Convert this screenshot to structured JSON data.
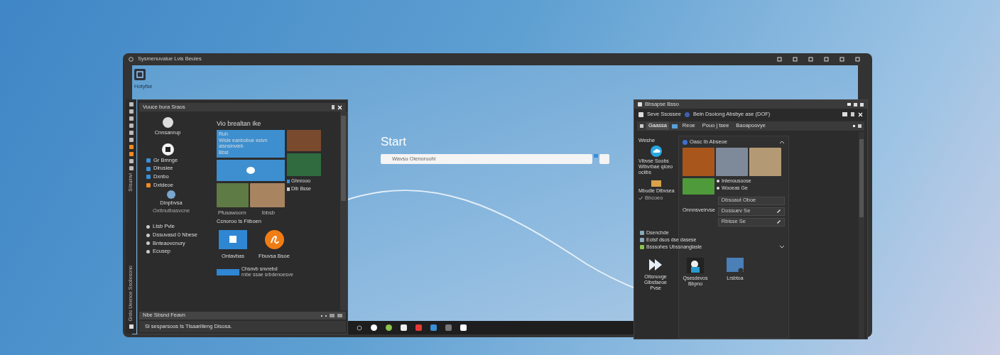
{
  "monitor": {
    "title": "Sysmenuvalue Lvis Beuies"
  },
  "desktop_icon": {
    "label": "Hotyfse"
  },
  "side_strip": {
    "labels": [
      "Siisuinvi",
      "Gislo Ueenoe Ssoliesono"
    ]
  },
  "left_window": {
    "title": "Vuuce bura Sraos",
    "profile": {
      "label": "Cnnsanrup"
    },
    "items": [
      {
        "label": "Gr Bmnge",
        "color": "#3a8fd8"
      },
      {
        "label": "Dlrusiee",
        "color": "#3a8fd8"
      },
      {
        "label": "Dxnbo",
        "color": "#3a8fd8"
      },
      {
        "label": "Dxtdeoe",
        "color": "#f08a24"
      }
    ],
    "account": {
      "label": "Dinpbvsa",
      "subtitle": "Oxttnutbasvcne"
    },
    "links": [
      "Ltsb Pvle",
      "Dssuvasd 0 Nbese",
      "Bnteaovcnury",
      "Ecusep"
    ],
    "heading": "Vio brealtan Ike",
    "feature": {
      "title": "Ruh",
      "text": "Wisle eanbobue esivn alsnsinvieb",
      "link": "Bbsl"
    },
    "side_captions": [
      "Ghnrooo",
      "Dlb Bsse"
    ],
    "photo_captions": [
      "Pfusawoorn",
      "Ibbsb"
    ],
    "apps_heading": "Ccnoroo ts Fiiboen",
    "apps": [
      {
        "label": "Ontavbas",
        "color": "#2f86d3",
        "kind": "tile"
      },
      {
        "label": "Fbuvsa Bsoe",
        "color": "#f07d14",
        "kind": "circle"
      }
    ],
    "promo": {
      "title": "Chsnvb snvrebd",
      "text": "rnbe ssae srbdenoesve"
    },
    "bottom_bar": "Nbe Sbsnd Feavn",
    "status": "Si sesparsoos ts Tlsaariileng Disosa."
  },
  "start": {
    "title": "Start",
    "search": {
      "placeholder": "Wavsu Oienoruohi"
    }
  },
  "right_window": {
    "title": "Bbsapse Bsso",
    "toolbar": [
      "Seve Ssossee",
      "Bein Dsoiong Absbye ase (DOF)"
    ],
    "tabs": [
      {
        "label": "Gaassa",
        "selected": true
      },
      {
        "label": "Reoe",
        "selected": false
      },
      {
        "label": "Pouo j tsee",
        "selected": false
      },
      {
        "label": "Baoapoovye",
        "selected": false
      }
    ],
    "sidebar": {
      "heading": "Weshe",
      "cloud_text": "Vlbvse Soobs Wibvrbae qiceo ociibs",
      "card_title": "Mbudle Dtbvsea",
      "card_check": {
        "label": "Bbcoeo",
        "checked": true
      },
      "section": "Onnnsveirvse"
    },
    "panel": {
      "title": "Oasc Ib Abseoe",
      "expanded": true,
      "options": [
        "Inlenousoose",
        "Wooeas Ge"
      ],
      "dropdown": "Dbsoaut Oboe",
      "fields": [
        "Dossuev Se",
        "Rbisse Se"
      ]
    },
    "list": [
      "Dsenchde",
      "Eotsf dsos dse dasese",
      "Bsssohes Ubssnanglasle"
    ],
    "apps": [
      {
        "label": "Oitsnuvge Glbsfaeoe Pvse",
        "kind": "arrow"
      },
      {
        "label": "Qsesdevos Bbpno",
        "kind": "robot"
      },
      {
        "label": "Lrsbtoa",
        "kind": "screen"
      }
    ]
  }
}
